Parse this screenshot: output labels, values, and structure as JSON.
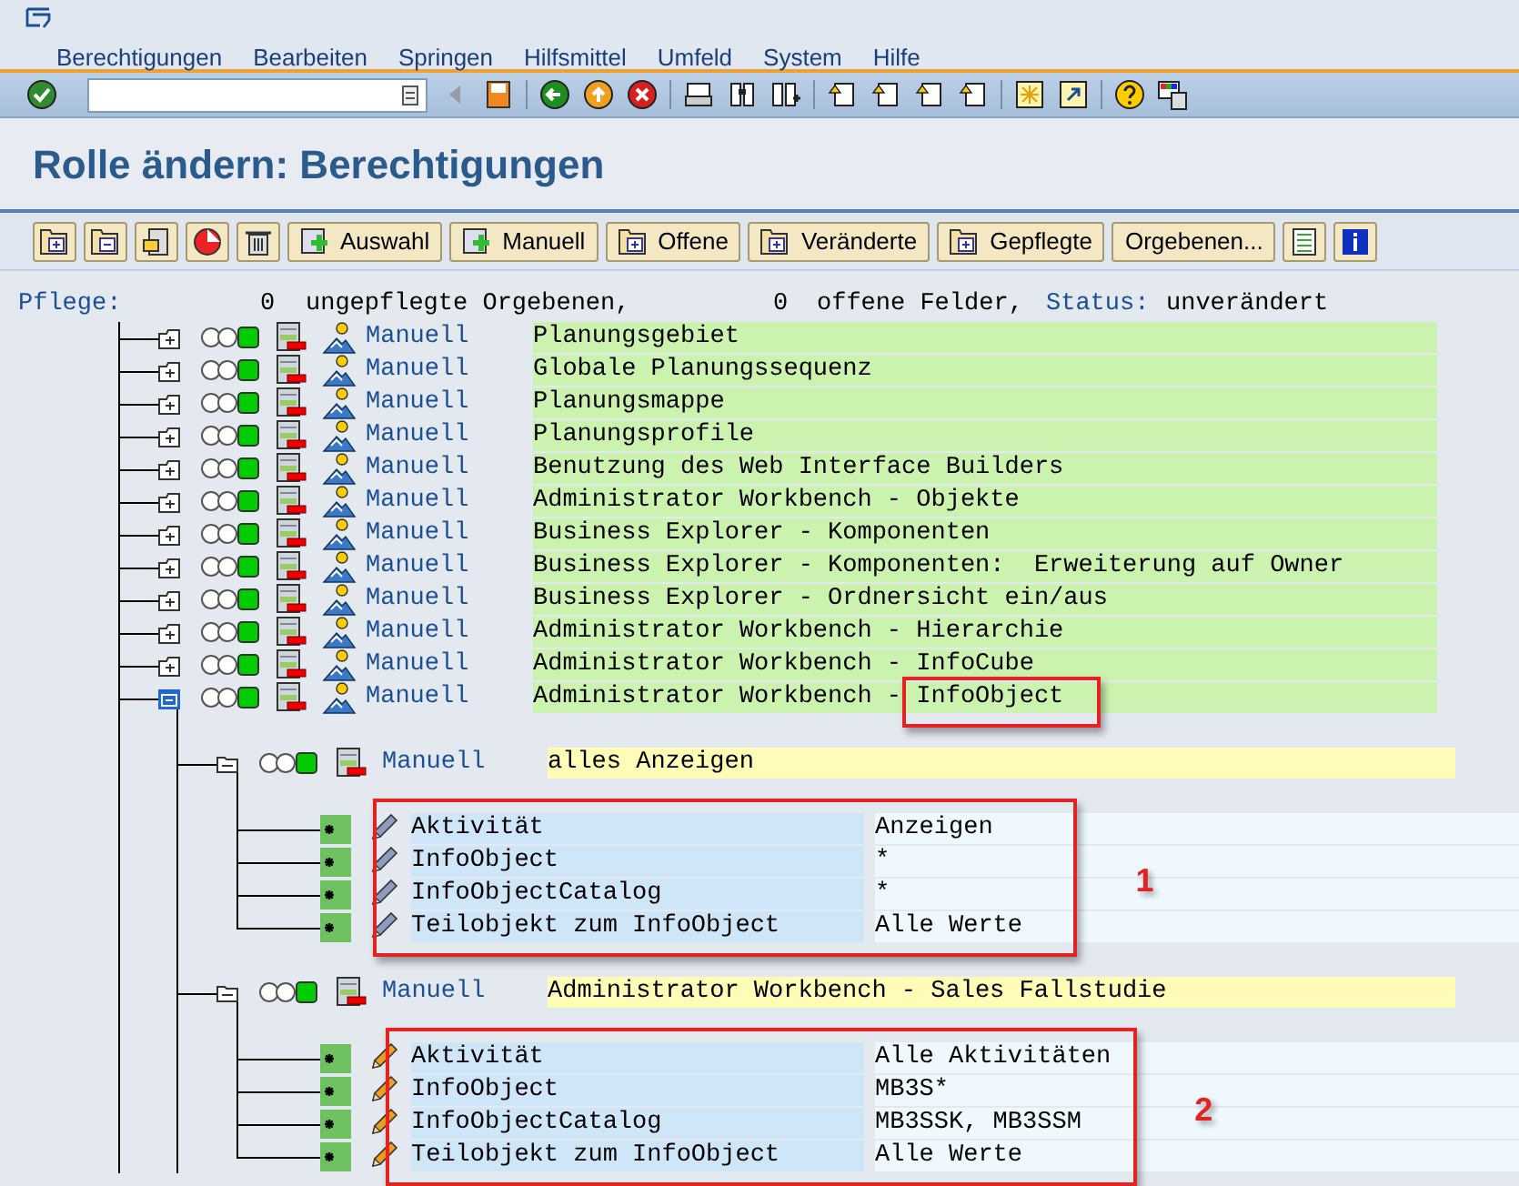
{
  "menu": [
    {
      "label": "Berechtigungen"
    },
    {
      "label": "Bearbeiten"
    },
    {
      "label": "Springen"
    },
    {
      "label": "Hilfsmittel"
    },
    {
      "label": "Umfeld"
    },
    {
      "label": "System"
    },
    {
      "label": "Hilfe"
    }
  ],
  "title": "Rolle ändern: Berechtigungen",
  "app_buttons": [
    {
      "kind": "icon_text",
      "label": "Auswahl"
    },
    {
      "kind": "icon_text",
      "label": "Manuell"
    },
    {
      "kind": "folder_text",
      "label": "Offene"
    },
    {
      "kind": "folder_text",
      "label": "Veränderte"
    },
    {
      "kind": "folder_text",
      "label": "Gepflegte"
    },
    {
      "kind": "text",
      "label": "Orgebenen..."
    }
  ],
  "status_line": {
    "label": "Pflege:",
    "unmaintained_count": "0",
    "unmaintained_text": "ungepflegte Orgebenen,",
    "open_count": "0",
    "open_text": "offene Felder,",
    "status_label": "Status:",
    "status_value": "unverändert"
  },
  "tree": [
    {
      "expanded": false,
      "label": "Manuell",
      "text": "Planungsgebiet"
    },
    {
      "expanded": false,
      "label": "Manuell",
      "text": "Globale Planungssequenz"
    },
    {
      "expanded": false,
      "label": "Manuell",
      "text": "Planungsmappe"
    },
    {
      "expanded": false,
      "label": "Manuell",
      "text": "Planungsprofile"
    },
    {
      "expanded": false,
      "label": "Manuell",
      "text": "Benutzung des Web Interface Builders"
    },
    {
      "expanded": false,
      "label": "Manuell",
      "text": "Administrator Workbench - Objekte"
    },
    {
      "expanded": false,
      "label": "Manuell",
      "text": "Business Explorer - Komponenten"
    },
    {
      "expanded": false,
      "label": "Manuell",
      "text": "Business Explorer - Komponenten:  Erweiterung auf Owner"
    },
    {
      "expanded": false,
      "label": "Manuell",
      "text": "Business Explorer - Ordnersicht ein/aus"
    },
    {
      "expanded": false,
      "label": "Manuell",
      "text": "Administrator Workbench - Hierarchie"
    },
    {
      "expanded": false,
      "label": "Manuell",
      "text": "Administrator Workbench - InfoCube"
    },
    {
      "expanded": true,
      "callout": true,
      "label": "Manuell",
      "text": "Administrator Workbench - InfoObject",
      "children": [
        {
          "expanded": true,
          "label": "Manuell",
          "text": "alles Anzeigen",
          "callout_number": "1",
          "fields": [
            {
              "name": "Aktivität",
              "value": "Anzeigen",
              "color": "#8c9cc0"
            },
            {
              "name": "InfoObject",
              "value": "*",
              "color": "#8c9cc0"
            },
            {
              "name": "InfoObjectCatalog",
              "value": "*",
              "color": "#8c9cc0"
            },
            {
              "name": "Teilobjekt zum InfoObject",
              "value": "Alle Werte",
              "color": "#8c9cc0"
            }
          ]
        },
        {
          "expanded": true,
          "label": "Manuell",
          "text": "Administrator Workbench - Sales Fallstudie",
          "callout_number": "2",
          "fields": [
            {
              "name": "Aktivität",
              "value": "Alle Aktivitäten",
              "color": "#f0a020"
            },
            {
              "name": "InfoObject",
              "value": "MB3S*",
              "color": "#f0a020"
            },
            {
              "name": "InfoObjectCatalog",
              "value": "MB3SSK, MB3SSM",
              "color": "#f0a020"
            },
            {
              "name": "Teilobjekt zum InfoObject",
              "value": "Alle Werte",
              "color": "#f0a020"
            }
          ]
        }
      ]
    }
  ]
}
